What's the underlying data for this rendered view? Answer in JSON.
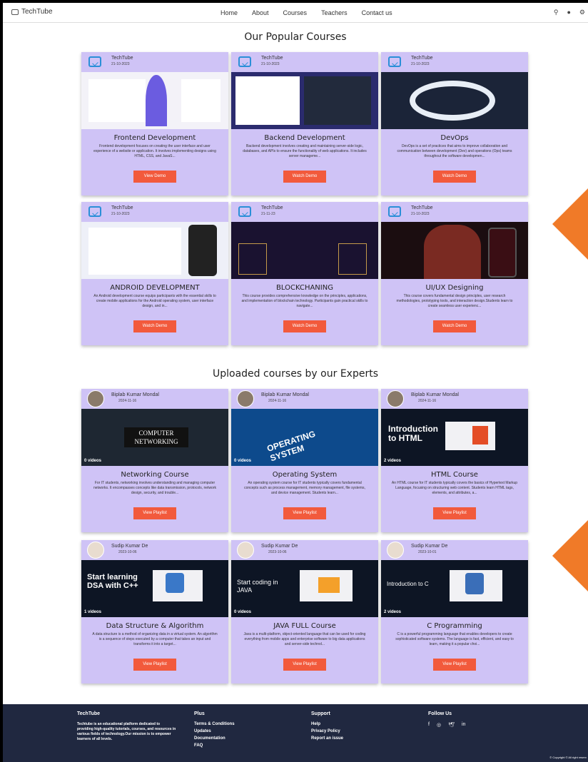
{
  "nav": {
    "logo": "TechTube",
    "links": [
      "Home",
      "About",
      "Courses",
      "Teachers",
      "Contact us"
    ],
    "icons": [
      "search-icon",
      "user-icon",
      "settings-icon"
    ]
  },
  "popular": {
    "title": "Our Popular Courses",
    "cards": [
      {
        "brand": "TechTube",
        "date": "21-10-2023",
        "title": "Frontend Development",
        "desc": "Frontend development focuses on creating the user interface and user experience of a website or application. It involves implementing designs using HTML, CSS, and JavaS...",
        "button": "View Demo"
      },
      {
        "brand": "TechTube",
        "date": "21-10-2023",
        "title": "Backend Development",
        "desc": "Backend development involves creating and maintaining server-side logic, databases, and APIs to ensure the functionality of web applications. It includes server manageme...",
        "button": "Watch Demo"
      },
      {
        "brand": "TechTube",
        "date": "21-10-2023",
        "title": "DevOps",
        "desc": "DevOps is a set of practices that aims to improve collaboration and communication between development (Dev) and operations (Ops) teams throughout the software developmen...",
        "button": "Watch Demo"
      },
      {
        "brand": "TechTube",
        "date": "21-10-2023",
        "title": "ANDROID DEVELOPMENT",
        "desc": "An Android development course equips participants with the essential skills to create mobile applications for the Android operating system, user interface design, and in...",
        "button": "Watch Demo"
      },
      {
        "brand": "TechTube",
        "date": "21-11-23",
        "title": "BLOCKCHANING",
        "desc": "This course provides comprehensive knowledge on the principles, applications, and implementation of blockchain technology. Participants gain practical skills to navigate...",
        "button": "Watch Demo"
      },
      {
        "brand": "TechTube",
        "date": "21-10-2023",
        "title": "UI/UX Designing",
        "desc": "This course covers fundamental design principles, user research methodologies, prototyping tools, and interaction design.Students learn to create seamless user experienc...",
        "button": "Watch Demo"
      }
    ]
  },
  "experts": {
    "title": "Uploaded courses by our Experts",
    "cards": [
      {
        "author": "Biplab Kumar Mondal",
        "date": "2024-11-16",
        "title": "Networking Course",
        "videos": "0 videos",
        "thumb_text": "COMPUTER NETWORKING",
        "desc": "For IT students, networking involves understanding and managing computer networks. It encompasses concepts like data transmission, protocols, network design, security, and trouble...",
        "button": "View Playlist"
      },
      {
        "author": "Biplab Kumar Mondal",
        "date": "2024-11-16",
        "title": "Operating System",
        "videos": "0 videos",
        "thumb_text": "OPERATING SYSTEM",
        "desc": "An operating system course for IT students typically covers fundamental concepts such as process management, memory management, file systems, and device management. Students learn...",
        "button": "View Playlist"
      },
      {
        "author": "Biplab Kumar Mondal",
        "date": "2024-11-16",
        "title": "HTML Course",
        "videos": "2 videos",
        "thumb_text": "Introduction to HTML",
        "desc": "An HTML course for IT students typically covers the basics of Hypertext Markup Language, focusing on structuring web content. Students learn HTML tags, elements, and attributes, a...",
        "button": "View Playlist"
      },
      {
        "author": "Sudip Kumar De",
        "date": "2023-10-06",
        "title": "Data Structure & Algorithm",
        "videos": "1 videos",
        "thumb_text": "Start learning DSA with C++",
        "desc": "A data structure is a method of organizing data in a virtual system. An algorithm is a sequence of steps executed by a computer that takes an input and transforms it into a target...",
        "button": "View Playlist"
      },
      {
        "author": "Sudip Kumar De",
        "date": "2023-10-06",
        "title": "JAVA FULL Course",
        "videos": "0 videos",
        "thumb_text": "Start coding in JAVA",
        "desc": "Java is a multi-platform, object-oriented language that can be used for coding everything from mobile apps and enterprise software to big data applications and server-side technol...",
        "button": "View Playlist"
      },
      {
        "author": "Sudip Kumar De",
        "date": "2023-10-01",
        "title": "C Programming",
        "videos": "2 videos",
        "thumb_text": "Introduction to C",
        "desc": "C is a powerful programming language that enables developers to create sophisticated software systems. The language is fast, efficient, and easy to learn, making it a popular choi...",
        "button": "View Playlist"
      }
    ]
  },
  "footer": {
    "brand": "TechTube",
    "about": "Techtube is an educational platform dedicated to providing high-quality tutorials, courses, and resources in various fields of technology.Our mission is to empower learners of all levels.",
    "cols": [
      {
        "head": "Plus",
        "items": [
          "Terms & Conditions",
          "Updates",
          "Documentation",
          "FAQ"
        ]
      },
      {
        "head": "Support",
        "items": [
          "Help",
          "Privacy Policy",
          "Report an issue"
        ]
      },
      {
        "head": "Follow Us",
        "items": []
      }
    ],
    "social": [
      "f",
      "◎",
      "🕊",
      "in"
    ],
    "copyright": "© Copyright © All right reserv"
  },
  "colors": {
    "card": "#cfc3f6",
    "button": "#f25a3c",
    "footer": "#202840",
    "arrow": "#f07a28"
  }
}
